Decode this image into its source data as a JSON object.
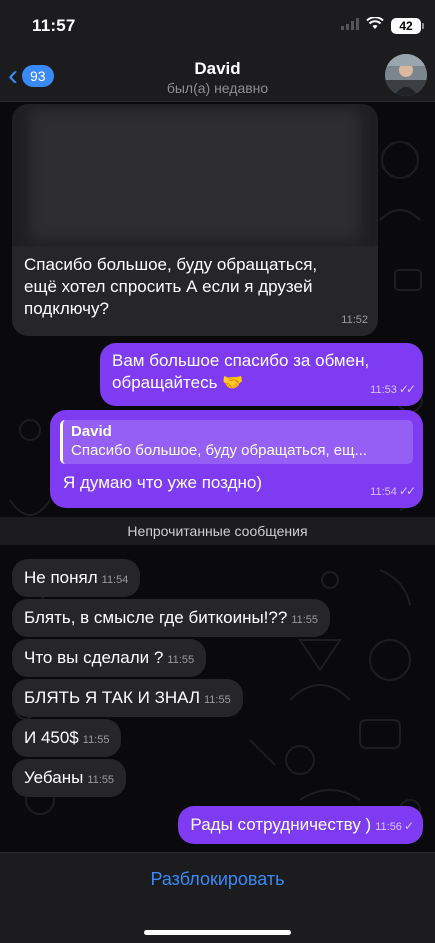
{
  "status_bar": {
    "time": "11:57",
    "battery": "42"
  },
  "header": {
    "back_count": "93",
    "contact_name": "David",
    "contact_status": "был(а) недавно"
  },
  "messages": [
    {
      "direction": "in",
      "text_lines": [
        "Спасибо большое, буду обращаться,",
        "ещё хотел спросить А если я друзей",
        "подключу?"
      ],
      "time": "11:52"
    },
    {
      "direction": "out",
      "text_lines": [
        "Вам большое спасибо за обмен,",
        "обращайтесь 🤝"
      ],
      "time": "11:53"
    },
    {
      "direction": "out",
      "reply": {
        "name": "David",
        "text": "Спасибо большое, буду обращаться, ещ..."
      },
      "text": "Я думаю что уже поздно)",
      "time": "11:54"
    },
    {
      "direction": "in",
      "text": "Не понял",
      "time": "11:54"
    },
    {
      "direction": "in",
      "text": "Блять, в смысле где биткоины!??",
      "time": "11:55"
    },
    {
      "direction": "in",
      "text": "Что вы сделали ?",
      "time": "11:55"
    },
    {
      "direction": "in",
      "text": "БЛЯТЬ Я ТАК И ЗНАЛ",
      "time": "11:55"
    },
    {
      "direction": "in",
      "text": "И 450$",
      "time": "11:55"
    },
    {
      "direction": "in",
      "text": "Уебаны",
      "time": "11:55"
    },
    {
      "direction": "out",
      "text": "Рады сотрудничеству )",
      "time": "11:56"
    }
  ],
  "unread_divider": "Непрочитанные сообщения",
  "bottom": {
    "action_label": "Разблокировать"
  },
  "colors": {
    "accent": "#3a8af5",
    "outgoing_bubble": "#7e3bf2",
    "incoming_bubble": "#262628"
  },
  "icons": [
    "back-chevron-icon",
    "wifi-icon",
    "signal-icon",
    "battery-icon",
    "double-check-icon",
    "single-check-icon"
  ]
}
